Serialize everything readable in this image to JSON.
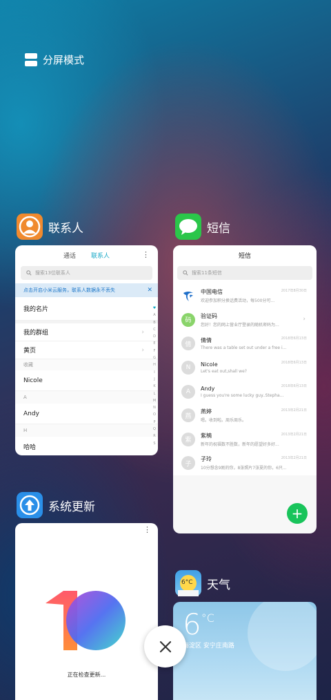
{
  "split_mode": {
    "label": "分屏模式"
  },
  "contacts": {
    "app_name": "联系人",
    "tabs": [
      "通话",
      "联系人"
    ],
    "search_placeholder": "搜索13位联系人",
    "banner": "点击开启小米云服务，联系人数据永不丢失",
    "rows": {
      "my_card": "我的名片",
      "my_groups": "我的群组",
      "yellow_pages": "黄页",
      "favorites_header": "收藏",
      "nicole": "Nicole",
      "section_a": "A",
      "andy": "Andy",
      "section_h": "H",
      "haha": "哈哈"
    },
    "index": [
      "♥",
      "A",
      "B",
      "C",
      "D",
      "E",
      "F",
      "G",
      "H",
      "I",
      "J",
      "K",
      "L",
      "M",
      "N",
      "O",
      "P",
      "Q",
      "R",
      "S"
    ]
  },
  "sms": {
    "app_name": "短信",
    "title": "短信",
    "search_placeholder": "搜索11条短信",
    "messages": [
      {
        "name": "中国电信",
        "preview": "欢迎参加积分换话费活动，每500分可...",
        "date": "2017年8月30日",
        "avatar": ""
      },
      {
        "name": "验证码",
        "preview": "您好！您的网上营业厅登录的随机密码为...",
        "date": "",
        "avatar": "码"
      },
      {
        "name": "倩倩",
        "preview": "There was a table set out under a free i...",
        "date": "2018年6月13日",
        "avatar": "倩"
      },
      {
        "name": "Nicole",
        "preview": "Let's eat out,shall we?",
        "date": "2018年6月13日",
        "avatar": "N"
      },
      {
        "name": "Andy",
        "preview": "I guess you're some lucky guy..Stepha...",
        "date": "2018年6月13日",
        "avatar": "A"
      },
      {
        "name": "燕婷",
        "preview": "嗯。收到啦。周乐周乐。",
        "date": "2013年2月21日",
        "avatar": "燕"
      },
      {
        "name": "紫楠",
        "preview": "新年的祝福数不胜数，新年的愿望好多好...",
        "date": "2013年2月21日",
        "avatar": "紫"
      },
      {
        "name": "子玲",
        "preview": "10分想念9刚的你，8张照片7张夏的你，6只...",
        "date": "2013年2月21日",
        "avatar": "子"
      }
    ]
  },
  "update": {
    "app_name": "系统更新",
    "status": "正在检查更新..."
  },
  "weather": {
    "app_name": "天气",
    "icon_temp": "6°C",
    "temp": "6",
    "unit": "°C",
    "location": "海淀区  安宁庄南路"
  },
  "colors": {
    "contacts_icon": "#f08a2e",
    "sms_icon": "#2bc64a",
    "update_icon": "#2a8fe8",
    "weather_icon": "#45a7ea",
    "accent": "#1aa9c7",
    "fab": "#19c45b"
  }
}
